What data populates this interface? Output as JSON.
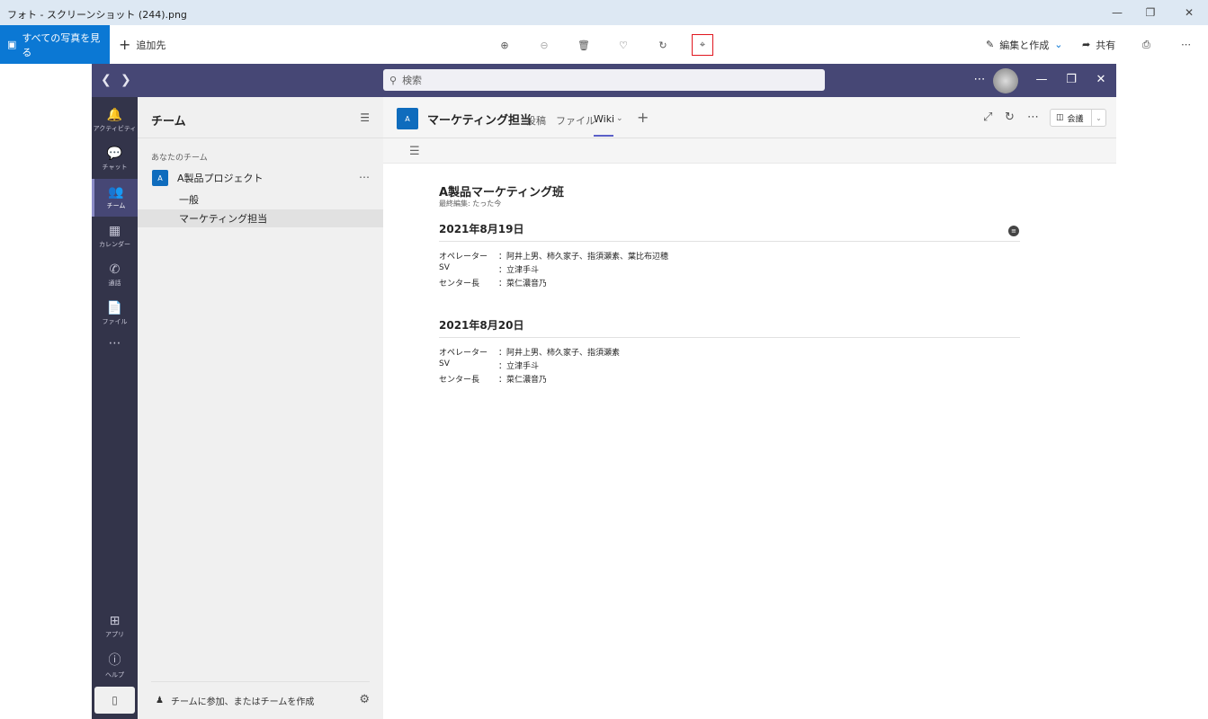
{
  "window": {
    "title": "フォト - スクリーンショット (244).png"
  },
  "photos_toolbar": {
    "all_photos_label": "すべての写真を見る",
    "add_to_label": "追加先",
    "edit_create_label": "編集と作成",
    "share_label": "共有"
  },
  "teams": {
    "search_placeholder": "検索",
    "rail": [
      {
        "label": "アクティビティ",
        "icon": "bell-icon"
      },
      {
        "label": "チャット",
        "icon": "chat-icon"
      },
      {
        "label": "チーム",
        "icon": "teams-icon"
      },
      {
        "label": "カレンダー",
        "icon": "calendar-icon"
      },
      {
        "label": "通話",
        "icon": "phone-icon"
      },
      {
        "label": "ファイル",
        "icon": "file-icon"
      }
    ],
    "rail_bottom": [
      {
        "label": "アプリ",
        "icon": "apps-icon"
      },
      {
        "label": "ヘルプ",
        "icon": "help-icon"
      }
    ],
    "team_list": {
      "header": "チーム",
      "section_label": "あなたのチーム",
      "team_name": "A製品プロジェクト",
      "team_badge": "A",
      "channels": [
        "一般",
        "マーケティング担当"
      ],
      "join_label": "チームに参加、またはチームを作成"
    },
    "channel_header": {
      "badge": "A",
      "title": "マーケティング担当",
      "tabs": [
        "投稿",
        "ファイル",
        "Wiki"
      ],
      "meeting_label": "会議"
    },
    "wiki": {
      "page_title": "A製品マーケティング班",
      "last_edited": "最終編集: たった今",
      "sections": [
        {
          "title": "2021年8月19日",
          "rows": [
            {
              "key": "オペレーター",
              "value": "：阿井上男、柿久家子、指須瀬素、葉比布辺穂"
            },
            {
              "key": "SV",
              "value": "：立津手斗"
            },
            {
              "key": "センター長",
              "value": "：菜仁濃音乃"
            }
          ]
        },
        {
          "title": "2021年8月20日",
          "rows": [
            {
              "key": "オペレーター",
              "value": "：阿井上男、柿久家子、指須瀬素"
            },
            {
              "key": "SV",
              "value": "：立津手斗"
            },
            {
              "key": "センター長",
              "value": "：菜仁濃音乃"
            }
          ]
        }
      ]
    }
  }
}
